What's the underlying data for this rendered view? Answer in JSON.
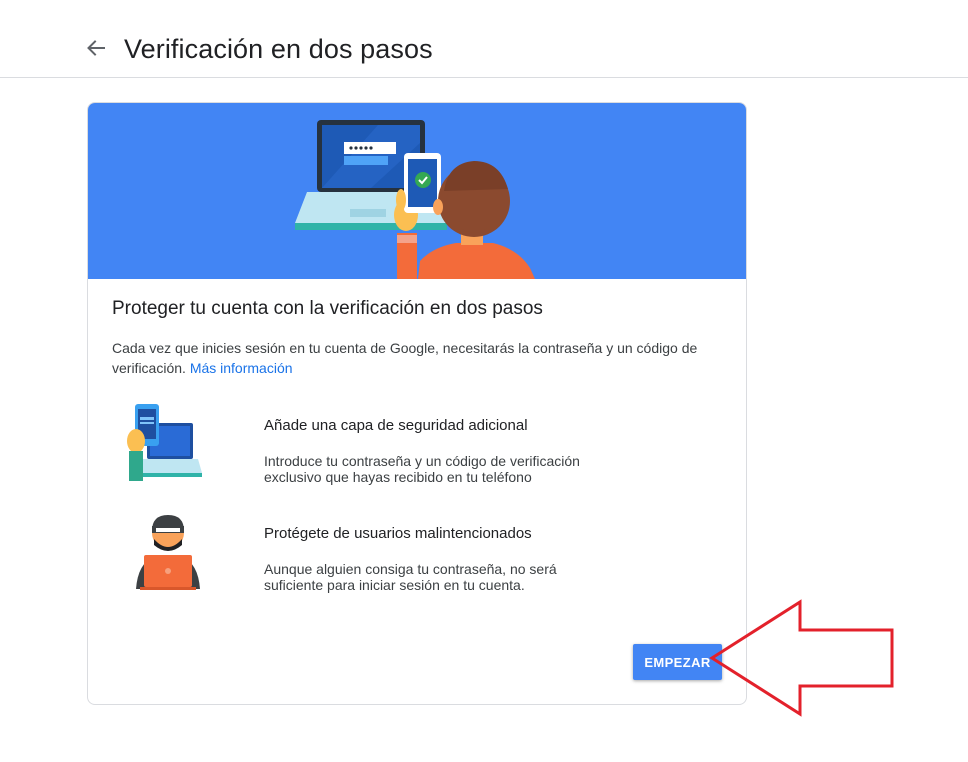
{
  "header": {
    "title": "Verificación en dos pasos",
    "back_icon": "arrow-left-icon"
  },
  "card": {
    "heading": "Proteger tu cuenta con la verificación en dos pasos",
    "description": "Cada vez que inicies sesión en tu cuenta de Google, necesitarás la contraseña y un código de verificación.",
    "learn_more": "Más información",
    "features": [
      {
        "icon": "phone-laptop-icon",
        "title": "Añade una capa de seguridad adicional",
        "line1": "Introduce tu contraseña y un código de verificación",
        "line2": "exclusivo que hayas recibido en tu teléfono"
      },
      {
        "icon": "hacker-icon",
        "title": "Protégete de usuarios malintencionados",
        "line1": "Aunque alguien consiga tu contraseña, no será",
        "line2": "suficiente para iniciar sesión en tu cuenta."
      }
    ],
    "start_button": "EMPEZAR"
  },
  "colors": {
    "accent": "#4285f4",
    "link": "#1a73e8",
    "annotation": "#e3212b"
  }
}
